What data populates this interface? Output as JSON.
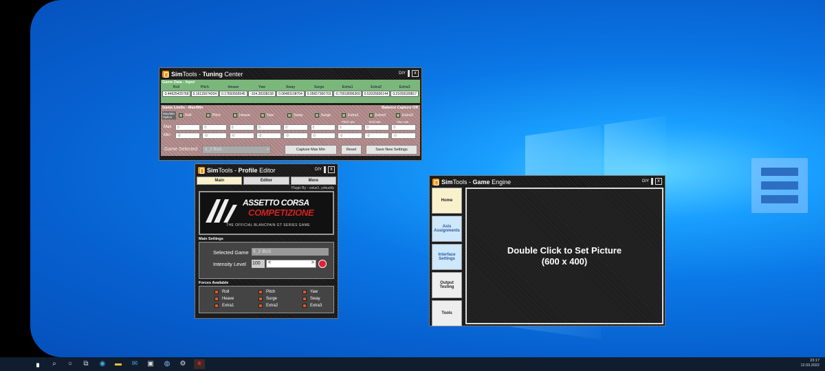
{
  "tuning_center": {
    "title_app": "Sim",
    "title_tools": "Tools",
    "title_sep": " - ",
    "title_bold": "Tuning",
    "title_rest": "Center",
    "diy": "DIY",
    "close": "x",
    "input_label": "Game Data - Input",
    "axes": [
      "Roll",
      "Pitch",
      "Heave",
      "Yaw",
      "Sway",
      "Surge",
      "Extra1",
      "Extra2",
      "Extra3"
    ],
    "values": [
      "-3.44625425768",
      "0.16115674204",
      "0.17693565545",
      "-104.28338158",
      "0.08483108704",
      "0.05657366703",
      "-0.70018996369",
      "0.52026836144",
      "0.21659189817"
    ],
    "limits_label": "Game Limits - Max/Min",
    "balance_label": "Balance Capture Off",
    "option_label": "Max/Min Option",
    "pitch_rate": "Pitch rate",
    "roll_rate": "Roll rate",
    "yaw_rate": "Yaw rate",
    "max_label": "Max",
    "min_label": "Min",
    "max_val": "0",
    "min_val": "-0",
    "game_selected_label": "Game Selected",
    "game_selected_value": "Il_2 BoS",
    "capture_btn": "Capture Max Min",
    "reset_btn": "Reset",
    "save_btn": "Save New Settings"
  },
  "profile_editor": {
    "title_app": "Sim",
    "title_tools": "Tools",
    "title_sep": " - ",
    "title_bold": "Profile",
    "title_rest": "Editor",
    "diy": "DIY",
    "close": "x",
    "tabs": [
      "Main",
      "Editor",
      "More"
    ],
    "plugin_by": "Plugin By - value1, yobuddy",
    "logo_line1": "ASSETTO CORSA",
    "logo_line2": "COMPETIZIONE",
    "logo_line3": "THE OFFICIAL BLANCPAIN GT SERIES GAME",
    "main_settings": "Main Settings",
    "selected_game_label": "Selected Game",
    "selected_game_value": "Il_2 BoS",
    "intensity_label": "Intensity Level",
    "intensity_value": "100",
    "slider_left": "<",
    "slider_right": ">",
    "forces_label": "Forces Available",
    "forces": [
      "Roll",
      "Pitch",
      "Yaw",
      "Heave",
      "Surge",
      "Sway",
      "Extra1",
      "Extra2",
      "Extra3"
    ]
  },
  "game_engine": {
    "title_app": "Sim",
    "title_tools": "Tools",
    "title_sep": " - ",
    "title_bold": "Game",
    "title_rest": "Engine",
    "diy": "DIY",
    "close": "x",
    "nav": [
      "Home",
      "Axis Assignments",
      "Interface Settings",
      "Output Testing",
      "Tools"
    ],
    "picture_line1": "Double Click to Set Picture",
    "picture_line2": "(600 x 400)"
  },
  "taskbar": {
    "time": "23:17",
    "date": "12.03.2022"
  },
  "colors": {
    "input_bg": "#7bb77b",
    "limits_bg": "#b28c8c",
    "checkbox_green": "#8fcc78",
    "force_orange": "#e05a2a",
    "active_tab": "#f8f1cc",
    "blue_nav": "#cde7fb"
  }
}
